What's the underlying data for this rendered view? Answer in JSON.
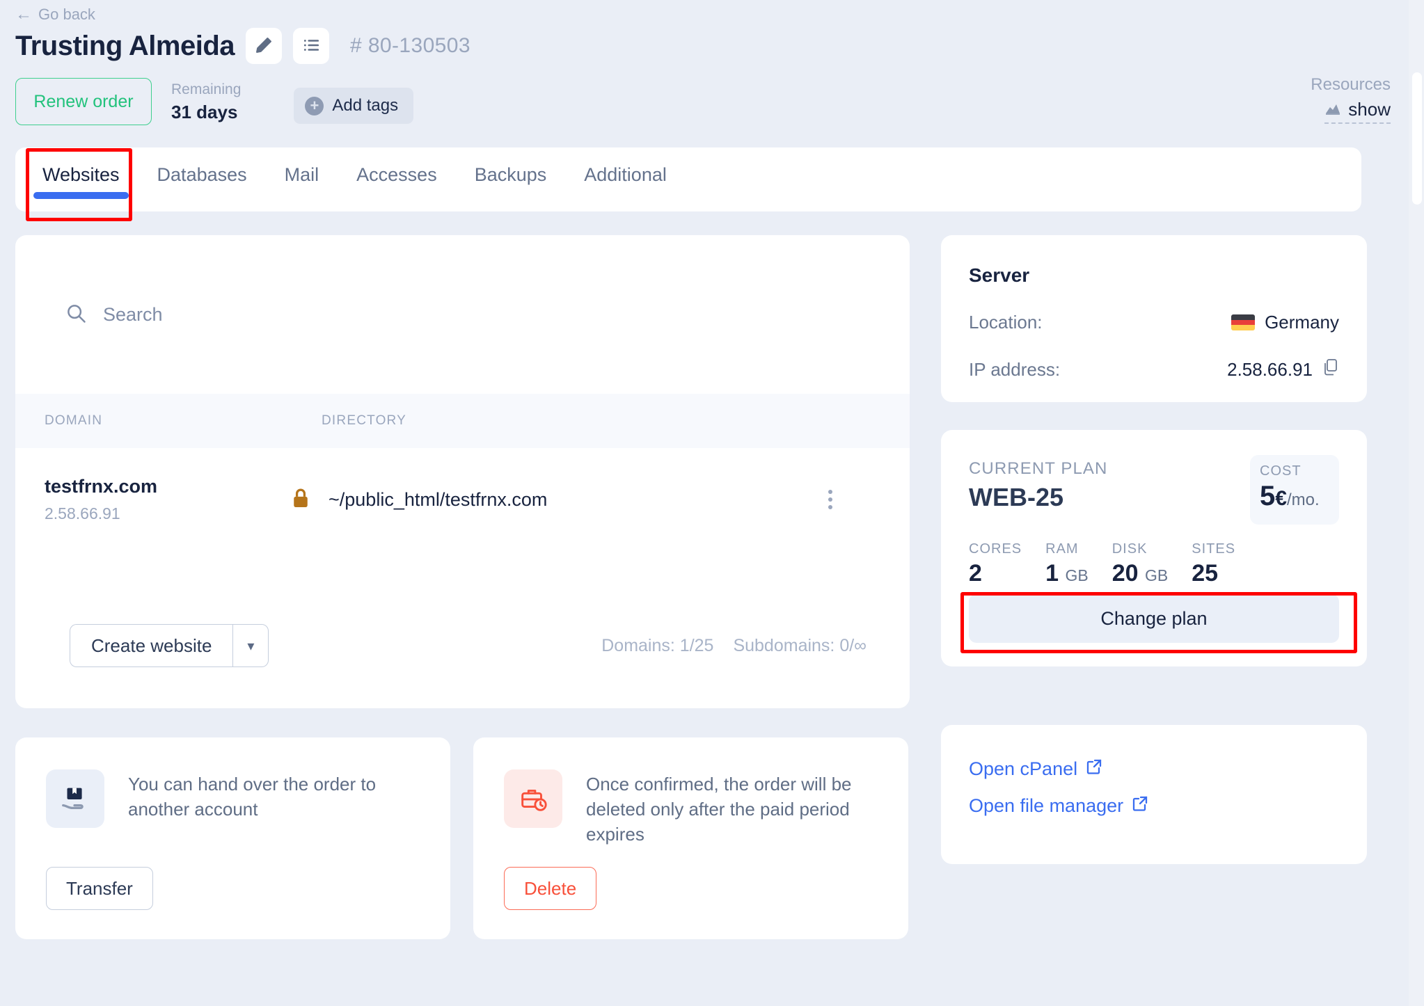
{
  "header": {
    "go_back": "Go back",
    "title": "Trusting Almeida",
    "order_number": "# 80-130503",
    "renew_label": "Renew order",
    "remaining_label": "Remaining",
    "remaining_value": "31 days",
    "add_tags_label": "Add tags",
    "edit_icon": "pencil-icon",
    "list_icon": "list-icon",
    "resources_label": "Resources",
    "resources_action": "show",
    "resources_icon": "chart-icon"
  },
  "tabs": [
    {
      "label": "Websites",
      "active": true
    },
    {
      "label": "Databases",
      "active": false
    },
    {
      "label": "Mail",
      "active": false
    },
    {
      "label": "Accesses",
      "active": false
    },
    {
      "label": "Backups",
      "active": false
    },
    {
      "label": "Additional",
      "active": false
    }
  ],
  "websites": {
    "search_placeholder": "Search",
    "search_value": "",
    "search_icon": "search-icon",
    "columns": [
      "DOMAIN",
      "DIRECTORY"
    ],
    "rows": [
      {
        "domain": "testfrnx.com",
        "ip": "2.58.66.91",
        "lock_icon": "lock-icon",
        "directory": "~/public_html/testfrnx.com",
        "menu_icon": "kebab-menu-icon"
      }
    ],
    "create_label": "Create website",
    "create_caret_icon": "chevron-down-icon",
    "domains_count": "Domains: 1/25",
    "subdomains_count": "Subdomains: 0/∞"
  },
  "transfer_card": {
    "icon": "hand-package-icon",
    "text": "You can hand over the order to another account",
    "button": "Transfer"
  },
  "delete_card": {
    "icon": "briefcase-clock-icon",
    "text": "Once confirmed, the order will be deleted only after the paid period expires",
    "button": "Delete"
  },
  "server": {
    "title": "Server",
    "location_label": "Location:",
    "location_value": "Germany",
    "location_flag": "germany-flag-icon",
    "ip_label": "IP address:",
    "ip_value": "2.58.66.91",
    "copy_icon": "copy-icon"
  },
  "plan": {
    "label": "CURRENT PLAN",
    "name": "WEB-25",
    "cost_label": "COST",
    "cost_value": "5",
    "cost_currency": "€",
    "cost_period": "/mo.",
    "specs": [
      {
        "label": "CORES",
        "value": "2",
        "unit": ""
      },
      {
        "label": "RAM",
        "value": "1",
        "unit": "GB"
      },
      {
        "label": "DISK",
        "value": "20",
        "unit": "GB"
      },
      {
        "label": "SITES",
        "value": "25",
        "unit": ""
      }
    ],
    "change_plan_label": "Change plan"
  },
  "links": [
    {
      "label": "Open cPanel",
      "icon": "external-link-icon"
    },
    {
      "label": "Open file manager",
      "icon": "external-link-icon"
    }
  ],
  "colors": {
    "accent_blue": "#3a6df0",
    "success_green": "#22c27c",
    "danger_red": "#f8503a",
    "highlight_red": "#fe0000",
    "page_bg": "#eaeef6"
  }
}
